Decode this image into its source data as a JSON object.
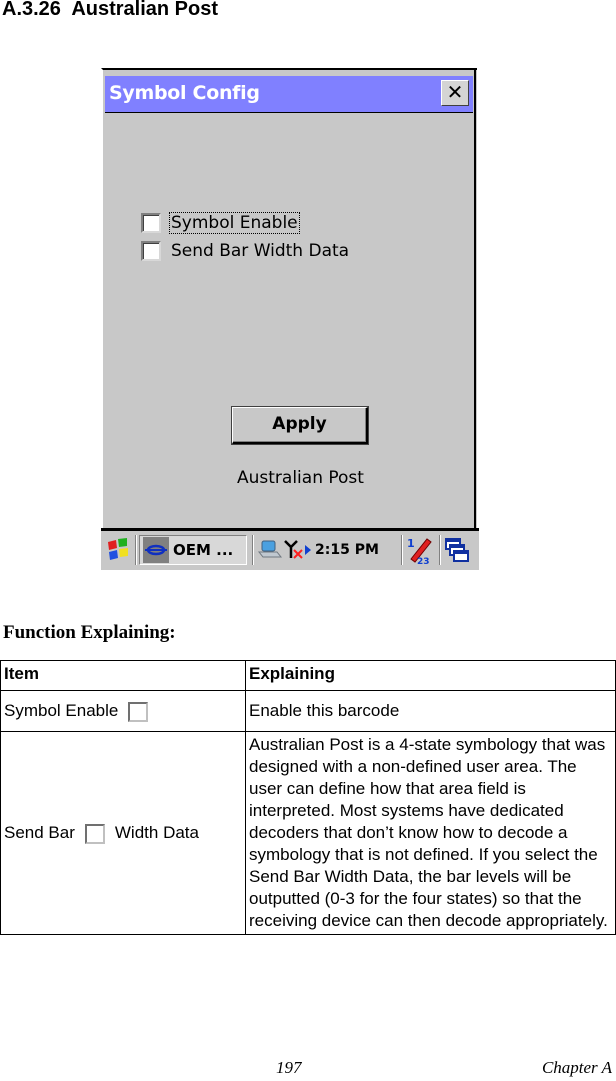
{
  "section": {
    "number": "A.3.26",
    "title": "Australian Post"
  },
  "dialog": {
    "title": "Symbol Config",
    "close_glyph": "✕",
    "checkboxes": [
      {
        "label": "Symbol Enable",
        "checked": false,
        "focused": true
      },
      {
        "label": "Send Bar Width Data",
        "checked": false,
        "focused": false
      }
    ],
    "apply_label": "Apply",
    "symbology_name": "Australian Post"
  },
  "taskbar": {
    "start_icon": "windows-flag-icon",
    "task_button_label": "OEM ...",
    "task_button_icon": "oem-app-icon",
    "tray_icons": [
      "network-icon",
      "no-signal-antenna-icon",
      "tray-expand-arrow-icon"
    ],
    "clock": "2:15 PM",
    "sip_icon": "input-panel-pen-icon",
    "windows_icon": "switch-windows-icon"
  },
  "function_explaining": {
    "heading": "Function Explaining:",
    "columns": [
      "Item",
      "Explaining"
    ],
    "rows": [
      {
        "item_before": "Symbol Enable",
        "item_after": "",
        "explaining": "Enable this barcode"
      },
      {
        "item_before": "Send Bar",
        "item_after": "Width Data",
        "explaining": "Australian Post is a 4-state symbology that was designed with a non-defined user area. The user can define how that area field is interpreted. Most systems have dedicated decoders that don’t know how to decode a symbology that is not defined. If you select the Send Bar Width Data, the bar levels will be outputted (0-3 for the four states) so that the receiving device can then decode appropriately."
      }
    ]
  },
  "footer": {
    "page_number": "197",
    "chapter": "Chapter A"
  }
}
